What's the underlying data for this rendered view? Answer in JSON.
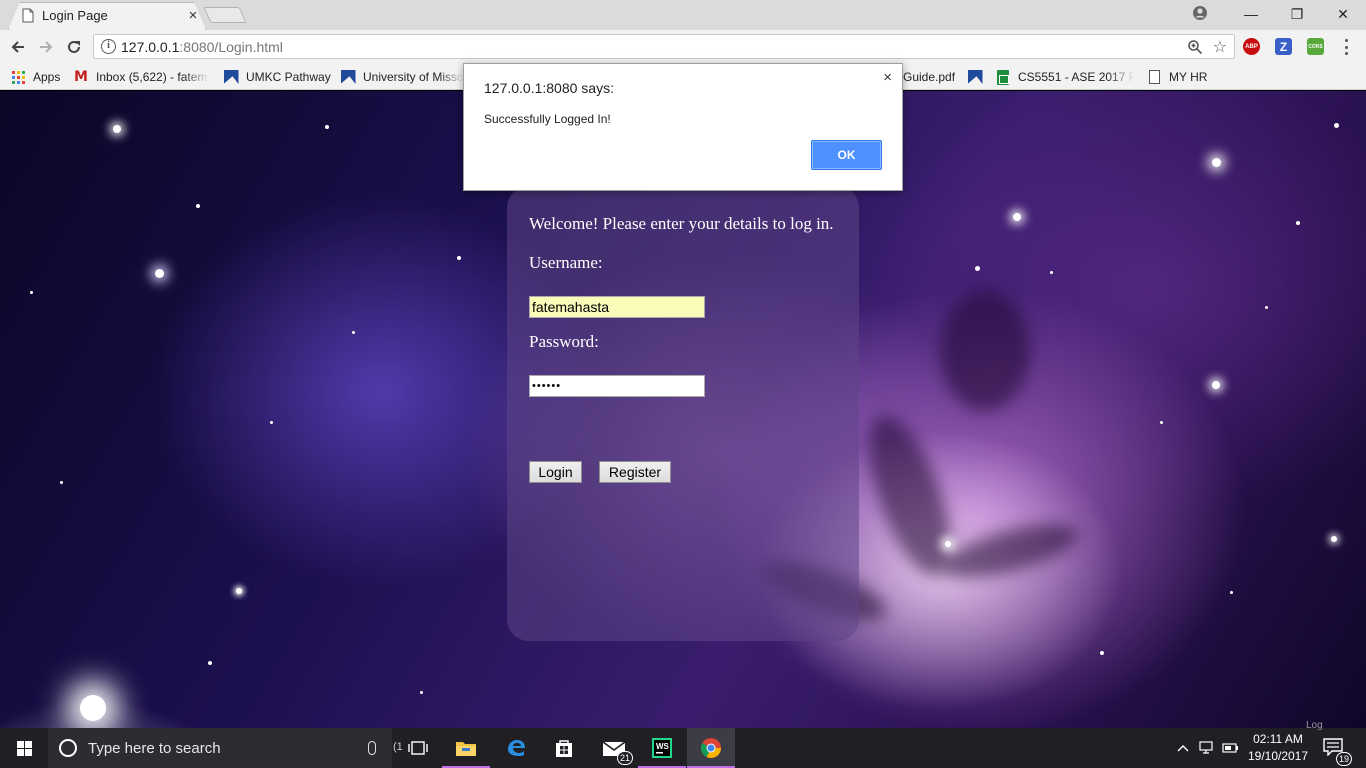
{
  "browser": {
    "tab_title": "Login Page",
    "tab_close": "×",
    "url_host": "127.0.0.1",
    "url_rest": ":8080/Login.html",
    "window_controls": {
      "minimize": "—",
      "maximize": "❐",
      "close": "✕"
    },
    "extensions": {
      "abp": "ABP",
      "z": "Z",
      "cors": "CORS"
    },
    "bookmarks": [
      {
        "label": "Apps",
        "icon": "apps-icon"
      },
      {
        "label": "Inbox (5,622) - fatem",
        "icon": "gmail-icon"
      },
      {
        "label": "UMKC Pathway",
        "icon": "umkc-icon"
      },
      {
        "label": "University of Misso",
        "icon": "umkc-icon"
      },
      {
        "label": "Guide.pdf",
        "icon": "pdf-icon"
      },
      {
        "label": "CS5551 - ASE 2017 F",
        "icon": "sheets-icon"
      },
      {
        "label": "MY HR",
        "icon": "document-icon"
      }
    ]
  },
  "login": {
    "welcome": "Welcome! Please enter your details to log in.",
    "username_label": "Username:",
    "username_value": "fatemahasta",
    "password_label": "Password:",
    "password_value": "••••••",
    "login_button": "Login",
    "register_button": "Register"
  },
  "alert": {
    "title": "127.0.0.1:8080 says:",
    "message": "Successfully Logged In!",
    "ok_button": "OK",
    "close": "×"
  },
  "taskbar": {
    "search_placeholder": "Type here to search",
    "mail_badge": "21",
    "time": "02:11 AM",
    "date": "19/10/2017",
    "notification_count": "19",
    "partial_window_text": "(1",
    "partial_overlay_text": "Log"
  },
  "colors": {
    "alert_ok": "#4d90fe",
    "username_field_bg": "#fafab9",
    "login_panel": "rgba(95,70,135,0.55)",
    "taskbar": "#1f1f24",
    "taskbar_active": "#c16fe8"
  }
}
